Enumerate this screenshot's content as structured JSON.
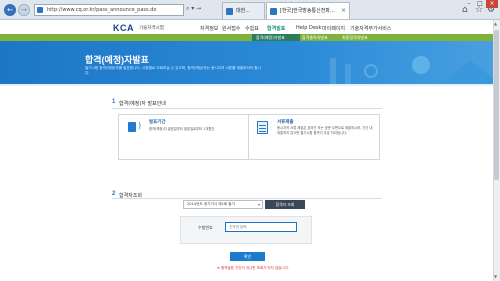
{
  "browser": {
    "back_icon": "arrow-left-icon",
    "forward_icon": "arrow-right-icon",
    "address": "http://www.cq.or.kr/pass_announce_pass.do",
    "search_glyph": "⌕ ▾ →",
    "tabs": [
      {
        "label": "대한...",
        "close": "×"
      },
      {
        "label": "[한국]한국방송통신전파...",
        "close": "×"
      }
    ],
    "toolbar_icons": [
      "home-icon",
      "star-icon",
      "gear-icon"
    ],
    "toolbar_glyphs": [
      "⌂",
      "☆",
      "⚙"
    ],
    "window_controls": [
      "–",
      "□",
      "×"
    ]
  },
  "site": {
    "logo": "KCA",
    "logo_sub": "기술자격시험",
    "menu": [
      "자격정보",
      "원서접수",
      "수험표",
      "합격발표",
      "Help Desk",
      "마이페이지",
      "기술자격부가서비스"
    ],
    "active_menu_index": 3,
    "submenu": [
      "합격(예정)자발표",
      "합격충족자발표",
      "최종합격자발표"
    ],
    "accent_color": "#1b9a77",
    "band_color": "#7fb23b"
  },
  "hero": {
    "title": "합격(예정)자발표",
    "desc": "필기시험 합격(예정)자를 발표합니다. 시험별로 조회하실 수 있으며, 합격(예정)자는 응시자격 서류를 제출하셔야 합니다."
  },
  "section1": {
    "num": "1",
    "title": "합격(예정)자 발표안내",
    "box1": {
      "icon": "speaker-icon",
      "title": "발표기간",
      "text": "합격(예정)자 발표일부터 발표일로부터 1개월간"
    },
    "box2": {
      "icon": "document-icon",
      "title": "서류제출",
      "text": "응시자격 서류 제출은 온라인 또는 방문·우편으로 제출하시며, 기간 내 제출하지 않으면 필기시험 합격이 무효 처리됩니다."
    }
  },
  "section2": {
    "num": "2",
    "title": "합격자조회",
    "select_value": "2014년도 정기기사 제1회 필기",
    "select_arrow": "▾",
    "select_button": "합격자 조회",
    "input_label": "수험번호",
    "input_placeholder": "숫자만 입력",
    "confirm_button": "확인",
    "notice": "※ 합격발표 기간이 지나면 조회가 되지 않습니다."
  },
  "scroll": {
    "up": "▲",
    "down": "▼"
  }
}
